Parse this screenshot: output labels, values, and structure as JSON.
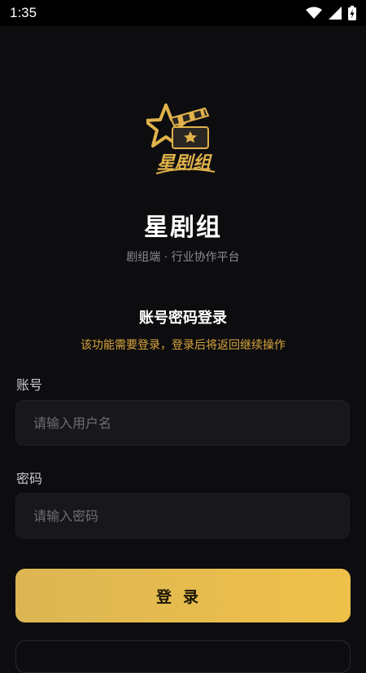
{
  "status_bar": {
    "time": "1:35",
    "icons": [
      "wifi-icon",
      "signal-icon",
      "battery-icon"
    ]
  },
  "logo": {
    "text": "星剧组"
  },
  "app": {
    "name": "星剧组",
    "subtitle": "剧组端 · 行业协作平台"
  },
  "login": {
    "title": "账号密码登录",
    "notice": "该功能需要登录，登录后将返回继续操作",
    "account_label": "账号",
    "account_placeholder": "请输入用户名",
    "account_value": "",
    "password_label": "密码",
    "password_placeholder": "请输入密码",
    "password_value": "",
    "button_label": "登录"
  },
  "colors": {
    "accent": "#efc14a",
    "notice": "#d9a63b",
    "background": "#0d0d10",
    "field": "#17171c"
  }
}
